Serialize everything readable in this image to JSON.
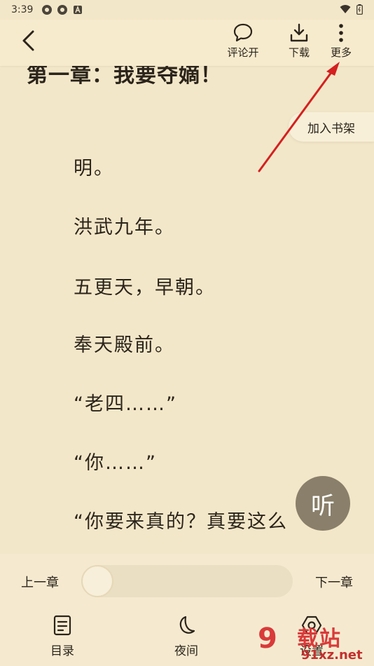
{
  "status": {
    "time": "3:39"
  },
  "header": {
    "comment_label": "评论开",
    "download_label": "下载",
    "more_label": "更多"
  },
  "content": {
    "chapter_title": "第一章：我要夺嫡！",
    "add_to_shelf": "加入书架",
    "paragraphs": [
      "明。",
      "洪武九年。",
      "五更天，早朝。",
      "奉天殿前。",
      "“老四……”",
      "“你……”",
      "“你要来真的？真要这么"
    ],
    "listen_label": "听"
  },
  "progress": {
    "prev_label": "上一章",
    "next_label": "下一章",
    "value": 0
  },
  "nav": {
    "toc_label": "目录",
    "night_label": "夜间",
    "settings_label": "设置"
  },
  "watermark": {
    "text": "载站",
    "url": "91xz.net"
  },
  "colors": {
    "background": "#f3e7c9",
    "annotation_arrow": "#d42020",
    "listen_button": "#8a7f6a"
  }
}
